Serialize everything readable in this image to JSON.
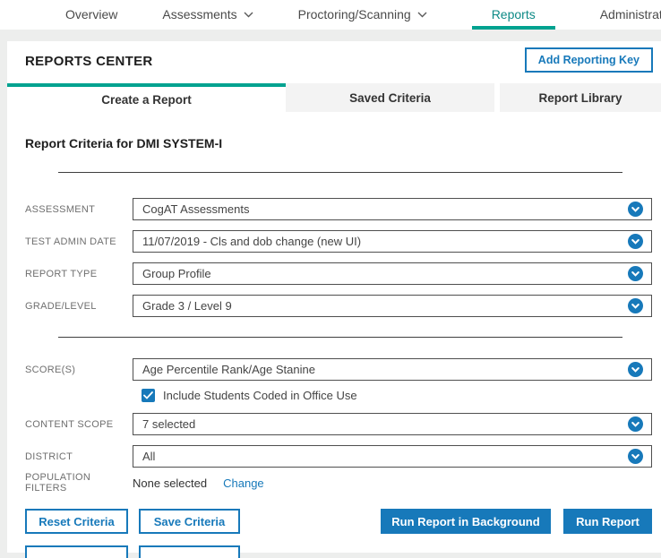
{
  "colors": {
    "teal": "#00a290",
    "teal_text": "#0d8a86",
    "accent_blue": "#1779ba"
  },
  "nav": {
    "items": [
      {
        "label": "Overview",
        "dropdown": false,
        "active": false
      },
      {
        "label": "Assessments",
        "dropdown": true,
        "active": false
      },
      {
        "label": "Proctoring/Scanning",
        "dropdown": true,
        "active": false
      },
      {
        "label": "Reports",
        "dropdown": false,
        "active": true
      },
      {
        "label": "Administration",
        "dropdown": true,
        "active": false
      }
    ]
  },
  "header": {
    "title": "REPORTS CENTER",
    "add_reporting_key": "Add Reporting Key"
  },
  "tabs": [
    {
      "label": "Create a Report",
      "active": true
    },
    {
      "label": "Saved Criteria",
      "active": false
    },
    {
      "label": "Report Library",
      "active": false
    }
  ],
  "report_criteria": {
    "heading": "Report Criteria for DMI SYSTEM-I",
    "fields": {
      "assessment": {
        "label": "ASSESSMENT",
        "value": "CogAT Assessments"
      },
      "test_admin_date": {
        "label": "TEST ADMIN DATE",
        "value": "11/07/2019 - Cls and dob change (new UI)"
      },
      "report_type": {
        "label": "REPORT TYPE",
        "value": "Group Profile"
      },
      "grade_level": {
        "label": "GRADE/LEVEL",
        "value": "Grade 3 / Level 9"
      },
      "scores": {
        "label": "SCORE(S)",
        "value": "Age Percentile Rank/Age Stanine"
      },
      "content_scope": {
        "label": "CONTENT SCOPE",
        "value": "7 selected"
      },
      "district": {
        "label": "DISTRICT",
        "value": "All"
      }
    },
    "include_office_use": {
      "label": "Include Students Coded in Office Use",
      "checked": true
    },
    "population_filters": {
      "label": "POPULATION FILTERS",
      "value": "None selected",
      "change_link": "Change"
    }
  },
  "actions": {
    "reset": "Reset Criteria",
    "save": "Save Criteria",
    "run_background": "Run Report in Background",
    "run": "Run Report"
  }
}
